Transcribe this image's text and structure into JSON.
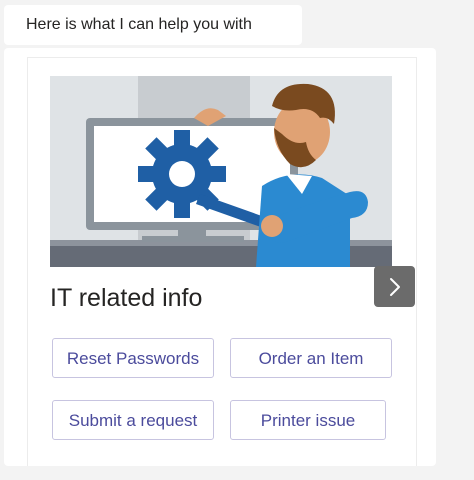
{
  "message": {
    "text": "Here is what I can help you with"
  },
  "card": {
    "image_description": "IT support illustration",
    "title": "IT related info",
    "actions": [
      {
        "label": "Reset Passwords"
      },
      {
        "label": "Order an Item"
      },
      {
        "label": "Submit a request"
      },
      {
        "label": "Printer issue"
      }
    ]
  },
  "carousel": {
    "next_icon": "chevron-right-icon"
  }
}
